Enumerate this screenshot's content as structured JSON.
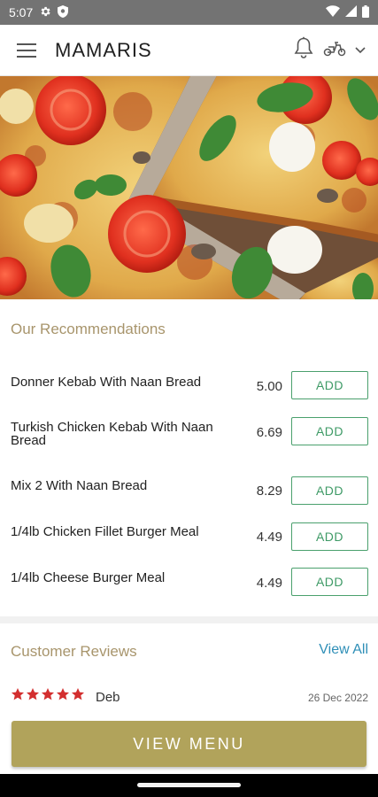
{
  "status_bar": {
    "time": "5:07",
    "icons": [
      "gear-icon",
      "shield-icon",
      "wifi-icon",
      "signal-icon",
      "battery-icon"
    ]
  },
  "header": {
    "title": "MAMARIS",
    "icons": [
      "hamburger-menu-icon",
      "bell-icon",
      "scooter-icon",
      "chevron-down-icon"
    ]
  },
  "hero": {
    "image": "pizza-hero-image"
  },
  "recommendations": {
    "title": "Our Recommendations",
    "items": [
      {
        "name": "Donner Kebab With Naan Bread",
        "price": "5.00",
        "action": "ADD"
      },
      {
        "name": "Turkish Chicken Kebab With Naan Bread",
        "price": "6.69",
        "action": "ADD"
      },
      {
        "name": "Mix 2 With Naan Bread",
        "price": "8.29",
        "action": "ADD"
      },
      {
        "name": "1/4lb Chicken Fillet Burger Meal",
        "price": "4.49",
        "action": "ADD"
      },
      {
        "name": "1/4lb Cheese Burger Meal",
        "price": "4.49",
        "action": "ADD"
      }
    ]
  },
  "reviews": {
    "title": "Customer Reviews",
    "view_all": "View All",
    "items": [
      {
        "rating": 5,
        "name": "Deb",
        "date": "26 Dec 2022"
      }
    ]
  },
  "view_menu": {
    "label": "VIEW MENU"
  },
  "colors": {
    "accent_gold": "#b1a35b",
    "section_title": "#a8956c",
    "add_green": "#3e9a66",
    "link_blue": "#2f8fb7",
    "star_red": "#d32f2f",
    "status_bar": "#737373"
  }
}
